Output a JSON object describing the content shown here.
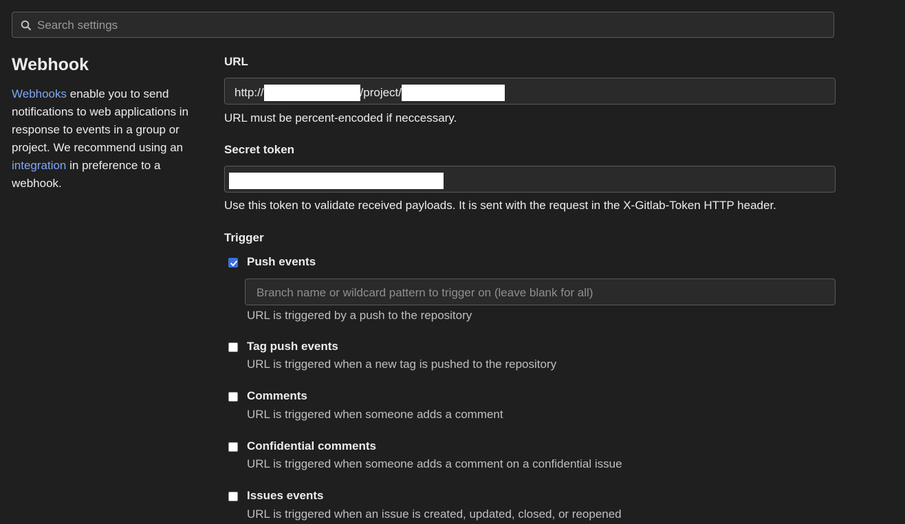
{
  "search": {
    "placeholder": "Search settings"
  },
  "section": {
    "title": "Webhook",
    "desc_link1": "Webhooks",
    "desc_part1": " enable you to send notifications to web applications in response to events in a group or project. We recommend using an ",
    "desc_link2": "integration",
    "desc_part2": " in preference to a webhook."
  },
  "url": {
    "label": "URL",
    "prefix": "http://",
    "middle": "/project/",
    "help": "URL must be percent-encoded if neccessary."
  },
  "secret": {
    "label": "Secret token",
    "help": "Use this token to validate received payloads. It is sent with the request in the X-Gitlab-Token HTTP header."
  },
  "trigger": {
    "label": "Trigger",
    "branch_placeholder": "Branch name or wildcard pattern to trigger on (leave blank for all)",
    "items": [
      {
        "label": "Push events",
        "help": "URL is triggered by a push to the repository",
        "checked": true
      },
      {
        "label": "Tag push events",
        "help": "URL is triggered when a new tag is pushed to the repository",
        "checked": false
      },
      {
        "label": "Comments",
        "help": "URL is triggered when someone adds a comment",
        "checked": false
      },
      {
        "label": "Confidential comments",
        "help": "URL is triggered when someone adds a comment on a confidential issue",
        "checked": false
      },
      {
        "label": "Issues events",
        "help": "URL is triggered when an issue is created, updated, closed, or reopened",
        "checked": false
      }
    ]
  },
  "colors": {
    "link": "#7ea7f5",
    "checkbox_checked": "#3b6fe0",
    "background": "#1f1f1f"
  },
  "icons": {
    "search": "search-icon",
    "check": "checkmark-icon"
  }
}
